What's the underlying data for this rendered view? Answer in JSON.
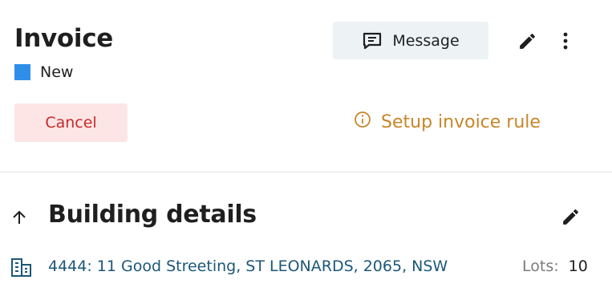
{
  "header": {
    "title": "Invoice",
    "status": {
      "label": "New",
      "color": "#2f8fe8"
    },
    "message_button": {
      "label": "Message",
      "icon": "message-icon"
    },
    "edit_icon": "edit-icon",
    "more_icon": "more-vertical-icon"
  },
  "actions": {
    "cancel_label": "Cancel",
    "setup_link": {
      "label": "Setup invoice rule",
      "icon": "info-icon",
      "color": "#c8862a"
    }
  },
  "section": {
    "title": "Building details",
    "collapse_icon": "arrow-up-icon",
    "edit_icon": "edit-icon",
    "building": {
      "icon": "building-icon",
      "address": "4444: 11 Good Streeting, ST LEONARDS, 2065, NSW",
      "lots_label": "Lots:",
      "lots_value": "10"
    }
  },
  "colors": {
    "cancel_bg": "#fde5e5",
    "cancel_text": "#c62a2a",
    "message_bg": "#edf2f5",
    "link": "#1c5778"
  }
}
